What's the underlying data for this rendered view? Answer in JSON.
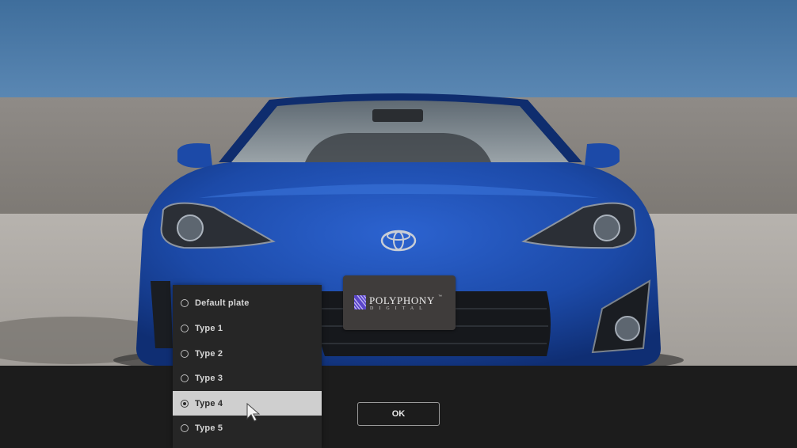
{
  "plate_menu": {
    "options": [
      {
        "label": "Default plate",
        "selected": false
      },
      {
        "label": "Type 1",
        "selected": false
      },
      {
        "label": "Type 2",
        "selected": false
      },
      {
        "label": "Type 3",
        "selected": false
      },
      {
        "label": "Type 4",
        "selected": true
      },
      {
        "label": "Type 5",
        "selected": false
      }
    ]
  },
  "ok_button": {
    "label": "OK"
  },
  "license_plate": {
    "brand": "POLYPHONY",
    "trademark": "™",
    "sub": "DIGITAL",
    "logo_color": "#5b46c9"
  },
  "colors": {
    "sky": "#4a78a6",
    "wall": "#8a8580",
    "car_body": "#1f4fb0",
    "ui_bg": "#1c1c1c",
    "selected_row": "#cfcfcf"
  }
}
